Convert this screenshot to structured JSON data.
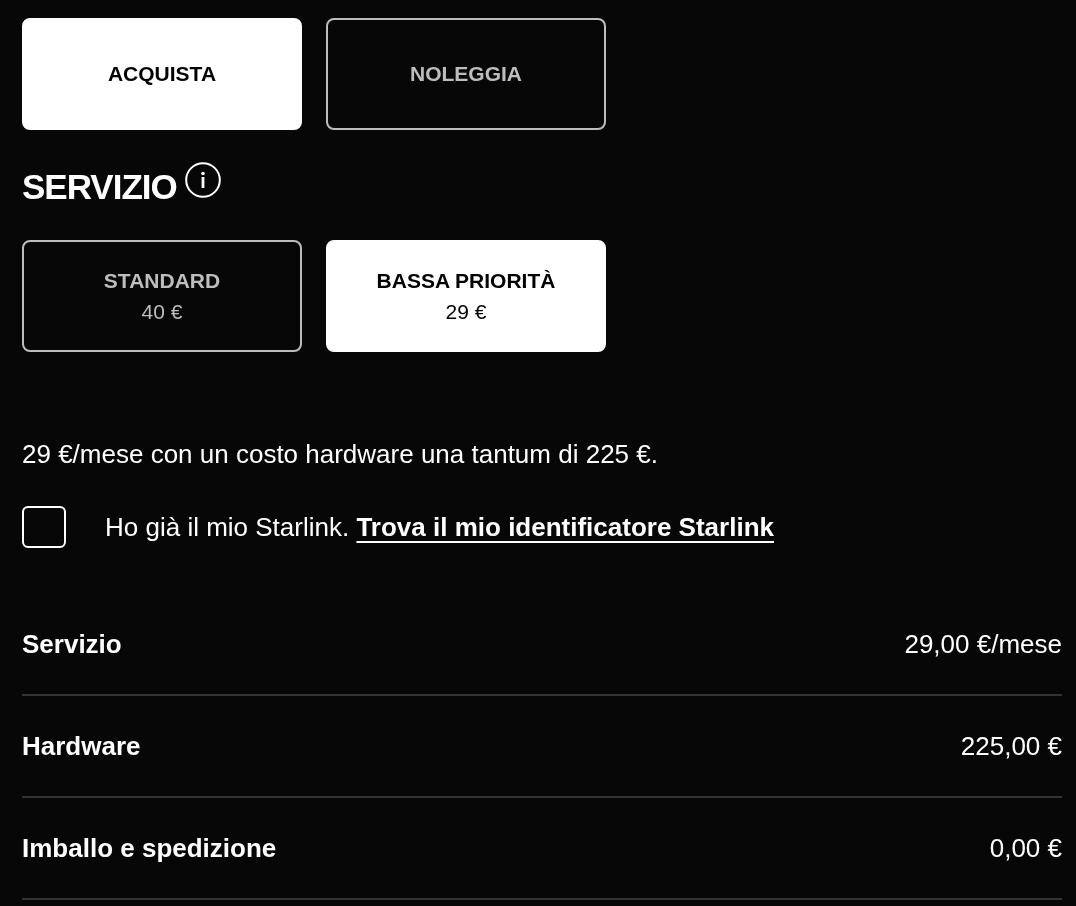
{
  "purchase_options": [
    {
      "label": "ACQUISTA",
      "selected": true
    },
    {
      "label": "NOLEGGIA",
      "selected": false
    }
  ],
  "service": {
    "title": "SERVIZIO",
    "plans": [
      {
        "name": "STANDARD",
        "price": "40 €",
        "selected": false
      },
      {
        "name": "BASSA PRIORITÀ",
        "price": "29 €",
        "selected": true
      }
    ]
  },
  "description": "29 €/mese con un costo hardware una tantum di 225 €.",
  "existing_starlink": {
    "checked": false,
    "label": "Ho già il mio Starlink.",
    "link": "Trova il mio identificatore Starlink"
  },
  "summary": [
    {
      "label": "Servizio",
      "value": "29,00 €/mese"
    },
    {
      "label": "Hardware",
      "value": "225,00 €"
    },
    {
      "label": "Imballo e spedizione",
      "value": "0,00 €"
    }
  ]
}
